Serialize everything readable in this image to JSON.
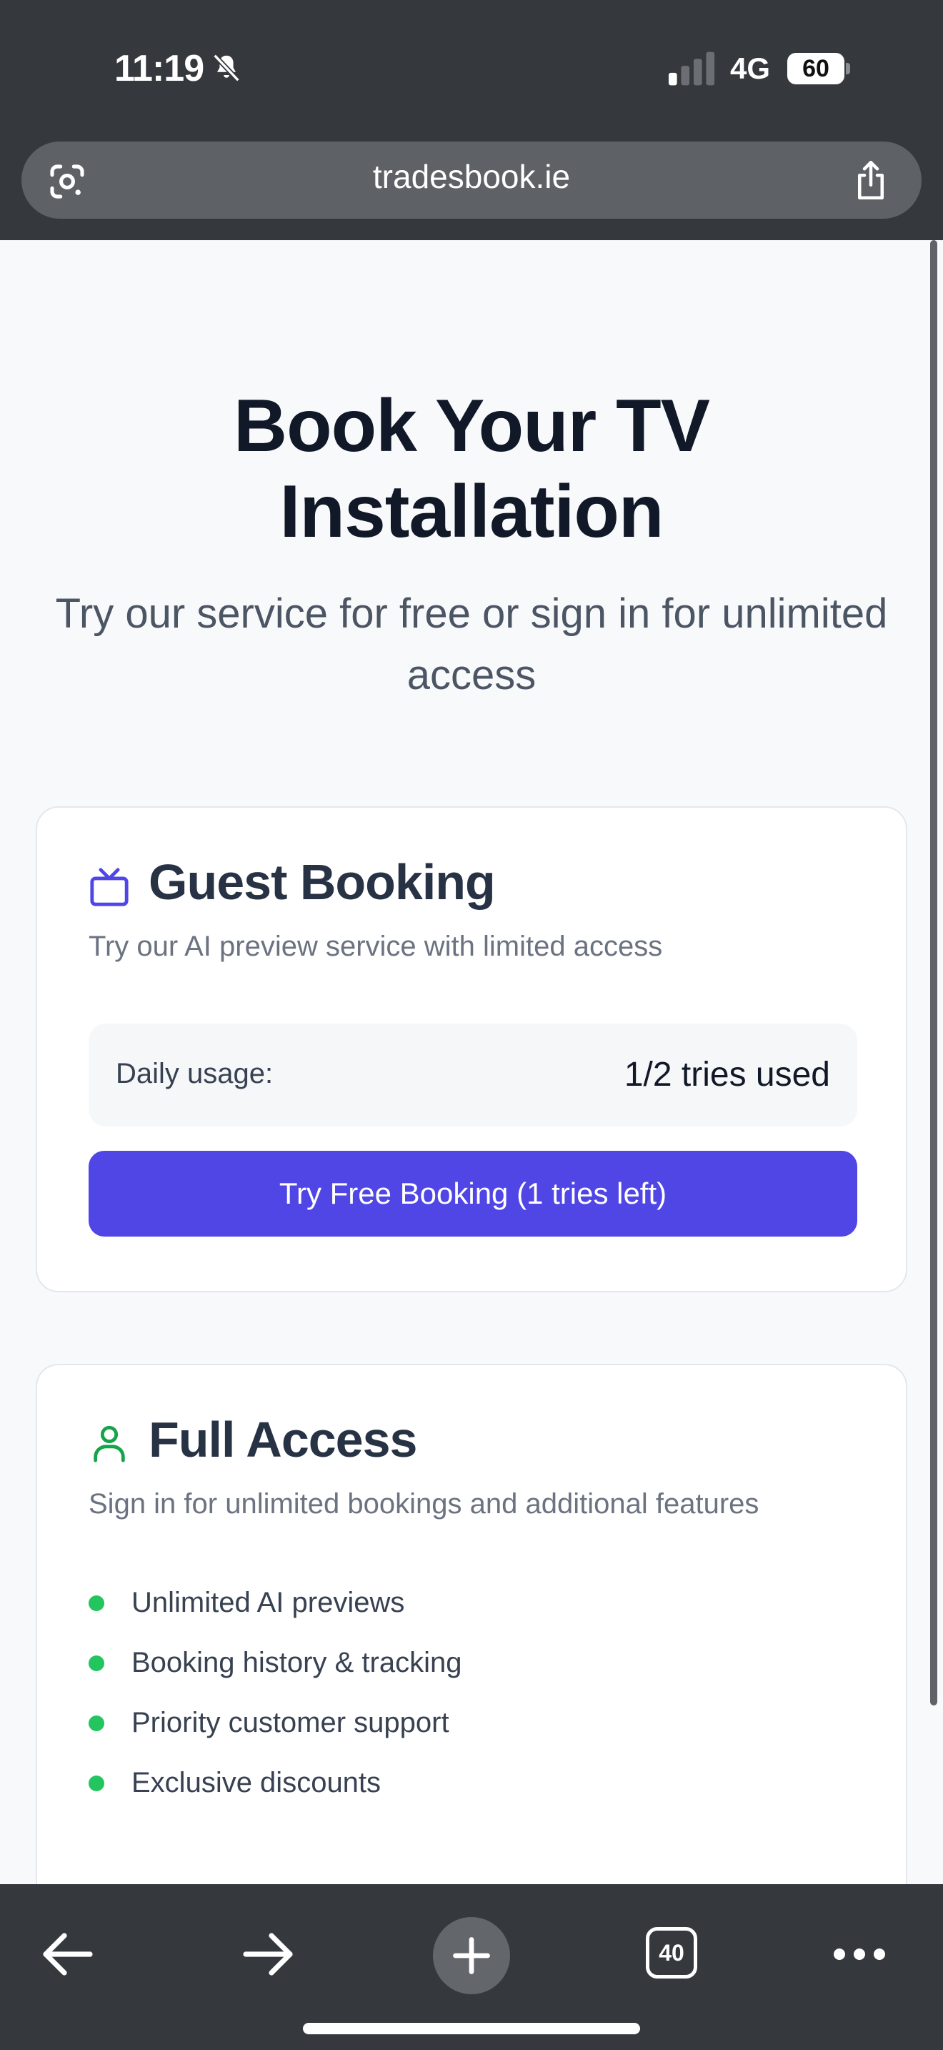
{
  "status_bar": {
    "time": "11:19",
    "network": "4G",
    "battery": "60",
    "icons": [
      "bell-slash-icon",
      "cellular-signal-icon",
      "battery-icon"
    ]
  },
  "browser": {
    "url": "tradesbook.ie",
    "icons": [
      "lens-icon",
      "share-icon",
      "back-arrow-icon",
      "forward-arrow-icon",
      "plus-icon",
      "more-icon"
    ],
    "tab_count": "40"
  },
  "hero": {
    "title": "Book Your TV Installation",
    "subtitle": "Try our service for free or sign in for unlimited access"
  },
  "guest_card": {
    "icon": "tv-icon",
    "title": "Guest Booking",
    "description": "Try our AI preview service with limited access",
    "usage_label": "Daily usage:",
    "usage_value": "1/2 tries used",
    "button_label": "Try Free Booking (1 tries left)"
  },
  "full_card": {
    "icon": "user-icon",
    "title": "Full Access",
    "description": "Sign in for unlimited bookings and additional features",
    "features": [
      "Unlimited AI previews",
      "Booking history & tracking",
      "Priority customer support",
      "Exclusive discounts"
    ]
  },
  "colors": {
    "chrome": "#35383d",
    "primary": "#4f46e5",
    "success": "#22c55e",
    "success_button": "#16a34a",
    "heading": "#111827"
  }
}
